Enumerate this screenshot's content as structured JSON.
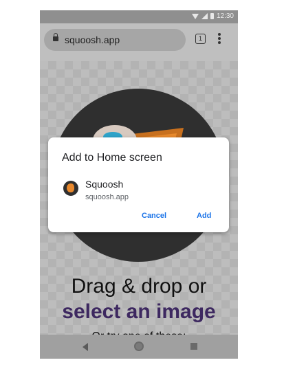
{
  "status_bar": {
    "time": "12:30"
  },
  "browser": {
    "url": "squoosh.app",
    "tab_count": "1"
  },
  "page": {
    "headline_line1": "Drag & drop or",
    "headline_line2": "select an image",
    "subtext": "Or try one of these:"
  },
  "dialog": {
    "title": "Add to Home screen",
    "app_name": "Squoosh",
    "app_url": "squoosh.app",
    "cancel_label": "Cancel",
    "add_label": "Add"
  },
  "colors": {
    "accent": "#1a73e8",
    "brand_purple": "#3d2860"
  },
  "icons": [
    "wifi-icon",
    "cell-signal-icon",
    "battery-icon",
    "lock-icon",
    "tab-switcher-icon",
    "more-menu-icon",
    "back-icon",
    "home-icon",
    "recents-icon"
  ]
}
